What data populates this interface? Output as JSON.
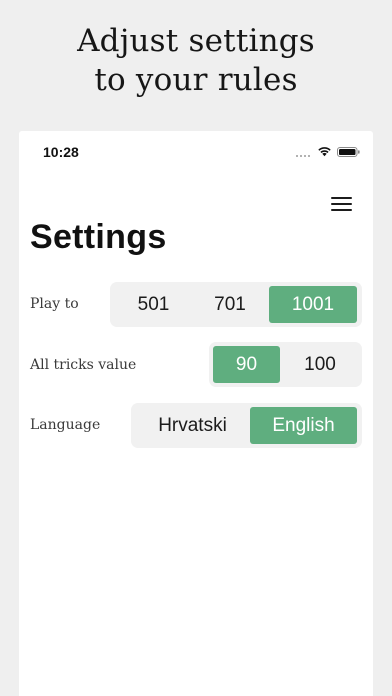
{
  "headline": {
    "line1": "Adjust settings",
    "line2": "to your rules"
  },
  "status_bar": {
    "time": "10:28",
    "icons": [
      "signal-dots-icon",
      "wifi-icon",
      "battery-icon"
    ]
  },
  "header": {
    "menu_icon": "hamburger-menu-icon"
  },
  "page": {
    "title": "Settings"
  },
  "settings": {
    "play_to": {
      "label": "Play to",
      "options": [
        "501",
        "701",
        "1001"
      ],
      "selected": "1001"
    },
    "all_tricks_value": {
      "label": "All tricks value",
      "options": [
        "90",
        "100"
      ],
      "selected": "90"
    },
    "language": {
      "label": "Language",
      "options": [
        "Hrvatski",
        "English"
      ],
      "selected": "English"
    }
  },
  "colors": {
    "accent": "#5fae7f",
    "segment_background": "#f1f1f1",
    "page_background": "#efefef",
    "card_background": "#ffffff"
  }
}
